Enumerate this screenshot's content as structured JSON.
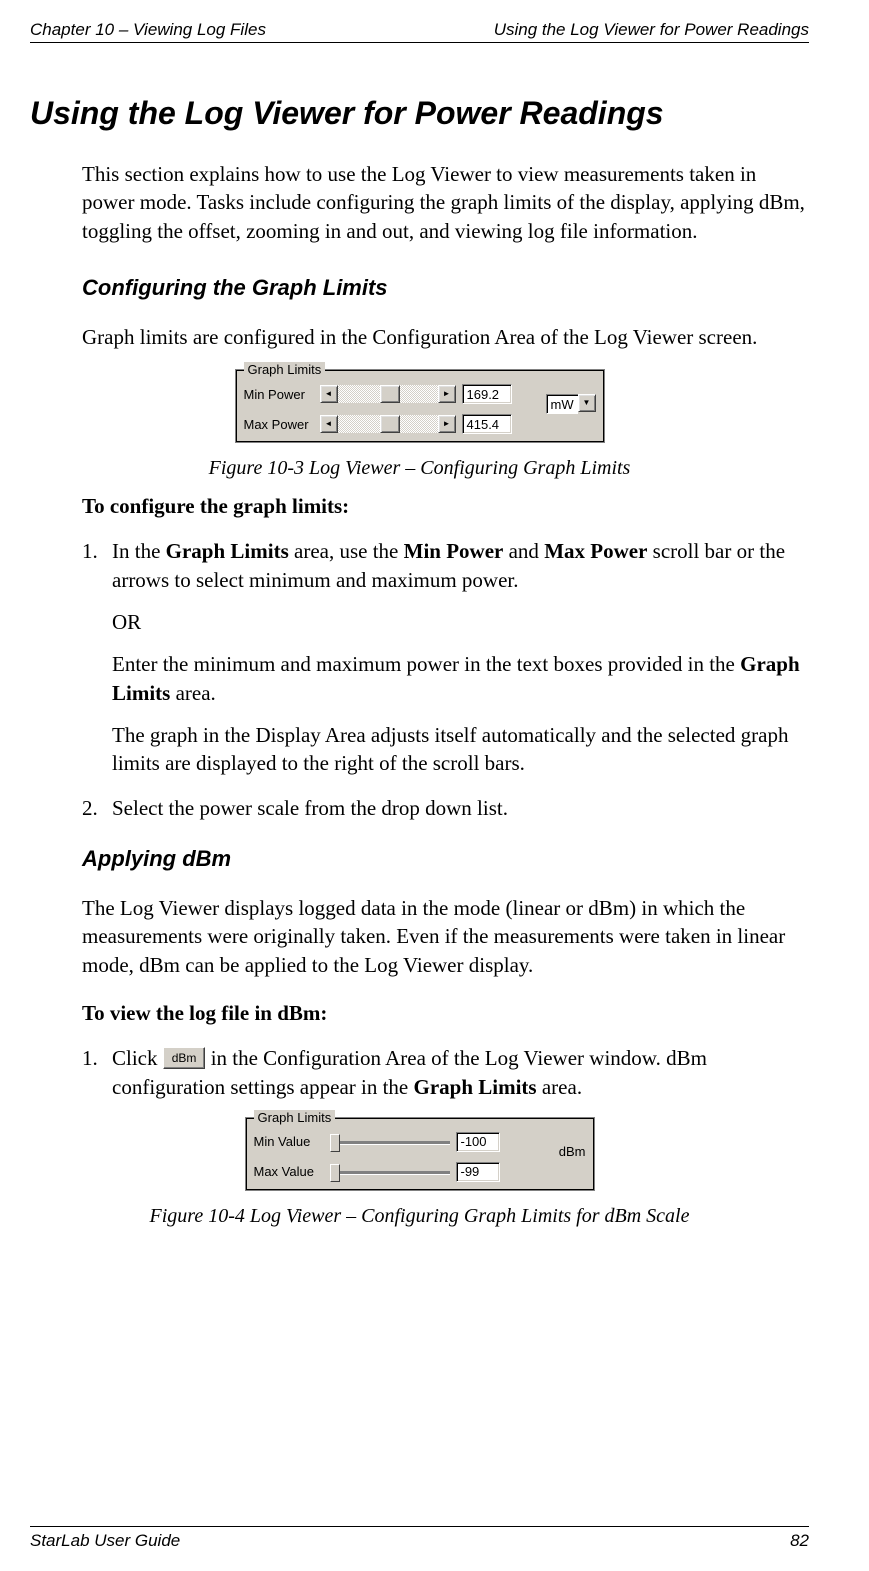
{
  "header": {
    "left": "Chapter 10 – Viewing Log Files",
    "right": "Using the Log Viewer for Power Readings"
  },
  "footer": {
    "left": "StarLab User Guide",
    "right": "82"
  },
  "h1": "Using the Log Viewer for Power Readings",
  "intro": "This section explains how to use the Log Viewer to view measurements taken in power mode. Tasks include configuring the graph limits of the display, applying dBm, toggling the offset, zooming in and out, and viewing log file information.",
  "section1": {
    "heading": "Configuring the Graph Limits",
    "p1": "Graph limits are configured in the Configuration Area of the Log Viewer screen.",
    "fig_caption": "Figure 10-3 Log Viewer – Configuring Graph Limits",
    "lead": "To configure the graph limits:",
    "step1_fragments": {
      "pre": "In the ",
      "b1": "Graph Limits",
      "mid1": " area, use the ",
      "b2": "Min Power",
      "mid2": " and ",
      "b3": "Max Power",
      "post": " scroll bar or the arrows to select minimum and maximum power."
    },
    "step1_or": "OR",
    "step1_p2a": "Enter the minimum and maximum power in the text boxes provided in the ",
    "step1_p2b": "Graph Limits",
    "step1_p2c": " area.",
    "step1_p3": "The graph in the Display Area adjusts itself automatically and the selected graph limits are displayed to the right of the scroll bars.",
    "step2": "Select the power scale from the drop down list."
  },
  "panel1": {
    "title": "Graph Limits",
    "row1_label": "Min Power",
    "row1_value": "169.2",
    "row2_label": "Max Power",
    "row2_value": "415.4",
    "unit": "mW"
  },
  "section2": {
    "heading": "Applying dBm",
    "p1": "The Log Viewer displays logged data in the mode (linear or dBm) in which the measurements were originally taken. Even if the measurements were taken in linear mode, dBm can be applied to the Log Viewer display.",
    "lead": "To view the log file in dBm:",
    "step1_fragments": {
      "pre": "Click ",
      "btn": "dBm",
      "mid": " in the Configuration Area of the Log Viewer window. dBm configuration settings appear in the ",
      "b1": "Graph Limits",
      "post": " area."
    },
    "fig_caption": "Figure 10-4 Log Viewer – Configuring Graph Limits for dBm Scale"
  },
  "panel2": {
    "title": "Graph Limits",
    "row1_label": "Min Value",
    "row1_value": "-100",
    "row2_label": "Max Value",
    "row2_value": "-99",
    "unit": "dBm"
  },
  "glyphs": {
    "left": "◄",
    "right": "►",
    "down": "▼"
  }
}
